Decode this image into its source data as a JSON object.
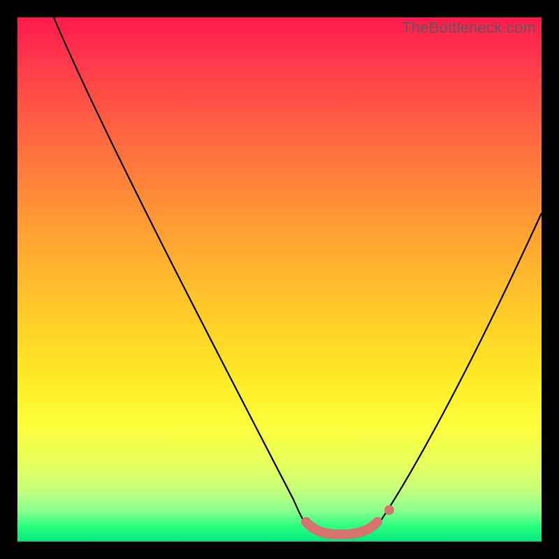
{
  "watermark": "TheBottleneck.com",
  "chart_data": {
    "type": "line",
    "title": "",
    "xlabel": "",
    "ylabel": "",
    "xlim": [
      0,
      100
    ],
    "ylim": [
      0,
      100
    ],
    "background": "rainbow-gradient-vertical",
    "series": [
      {
        "name": "bottleneck-curve",
        "color": "#000000",
        "x": [
          7,
          15,
          25,
          35,
          45,
          52,
          55,
          58,
          62,
          65,
          68,
          70,
          75,
          82,
          90,
          100
        ],
        "y": [
          100,
          86,
          70,
          54,
          38,
          22,
          12,
          5,
          2,
          2,
          2,
          5,
          15,
          30,
          48,
          70
        ]
      }
    ],
    "markers": [
      {
        "name": "highlight-region",
        "color": "#d6736e",
        "style": "thick-rounded",
        "x": [
          55,
          57,
          59,
          61,
          63,
          65,
          67,
          69
        ],
        "y": [
          3.5,
          2.0,
          1.5,
          1.2,
          1.2,
          1.5,
          2.5,
          4.5
        ]
      },
      {
        "name": "highlight-dot",
        "color": "#d6736e",
        "style": "dot",
        "x": [
          71
        ],
        "y": [
          7
        ]
      }
    ]
  }
}
